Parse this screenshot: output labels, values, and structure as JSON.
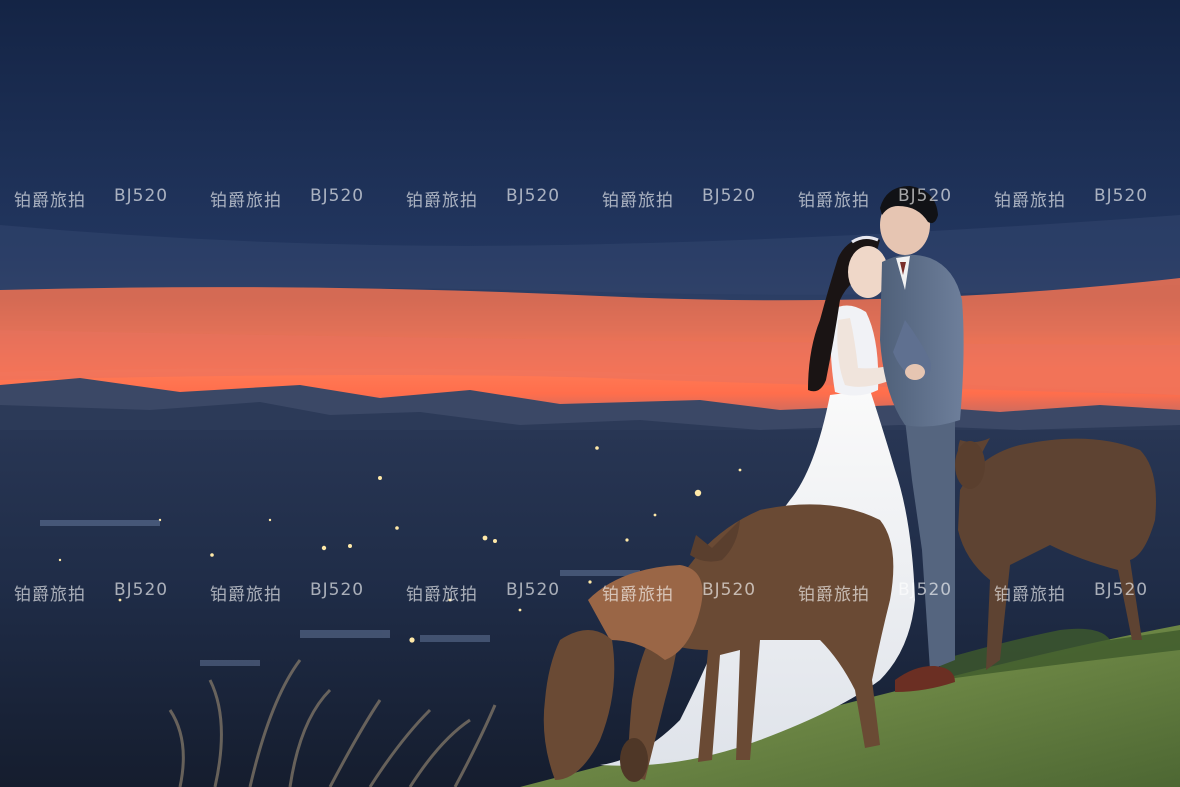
{
  "photo": {
    "subject": "Wedding couple with deer on a hillside at dusk",
    "watermark": {
      "brand_text": "铂爵旅拍",
      "code_text": "BJ520"
    },
    "colors": {
      "sky_top": "#1d2d52",
      "sky_band": "#ff7a52",
      "city": "#1f2d4a",
      "grass": "#617a3e",
      "dress": "#f5f5f7",
      "suit": "#5c6d88",
      "deer": "#6b4a33"
    }
  }
}
